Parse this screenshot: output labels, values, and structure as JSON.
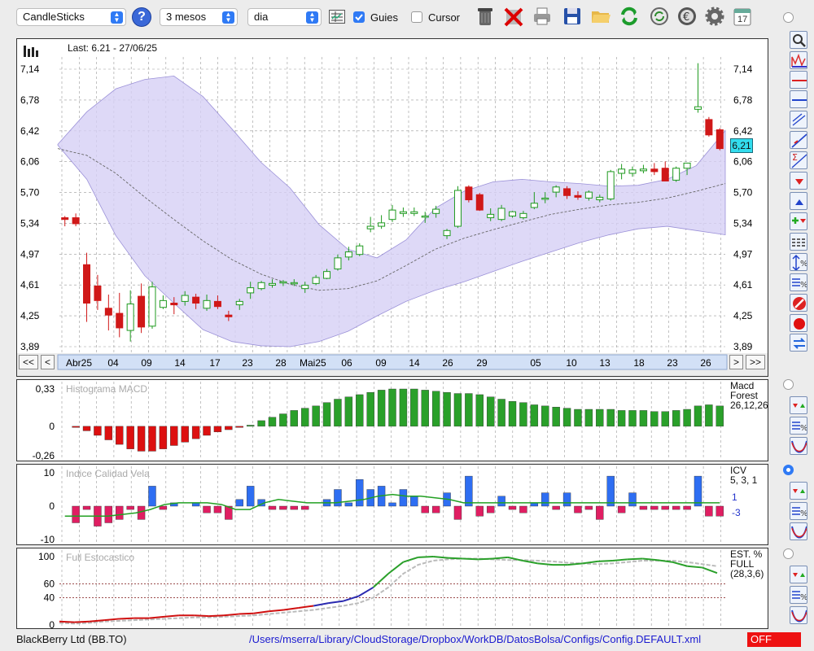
{
  "toolbar": {
    "chart_type": "CandleSticks",
    "period": "3 mesos",
    "interval": "dia",
    "guides_label": "Guies",
    "guides_checked": true,
    "cursor_label": "Cursor",
    "cursor_checked": false,
    "icons": [
      "help-icon",
      "table-icon",
      "trash-icon",
      "delete-icon",
      "printer-icon",
      "save-icon",
      "open-folder-icon",
      "refresh-icon",
      "sync-icon",
      "euro-icon",
      "gear-icon",
      "calendar-icon"
    ],
    "calendar_day": "17"
  },
  "main_chart": {
    "last_label": "Last: 6.21 - 27/06/25",
    "price_tag": "6,21",
    "y_ticks": [
      "7,14",
      "6,78",
      "6,42",
      "6,06",
      "5,70",
      "5,34",
      "4,97",
      "4,61",
      "4,25",
      "3,89"
    ],
    "x_labels": [
      "Abr25",
      "04",
      "09",
      "14",
      "17",
      "23",
      "28",
      "Mai25",
      "06",
      "09",
      "14",
      "26",
      "29",
      "05",
      "10",
      "13",
      "18",
      "23",
      "26"
    ],
    "nav_left": [
      "<<",
      "<"
    ],
    "nav_right": [
      ">",
      ">>"
    ],
    "ylim": [
      3.89,
      7.14
    ]
  },
  "chart_data": [
    {
      "type": "candlestick",
      "title": "",
      "y_ticks": [
        "7,14",
        "6,78",
        "6,42",
        "6,06",
        "5,70",
        "5,34",
        "4,97",
        "4,61",
        "4,25",
        "3,89"
      ],
      "x_labels": [
        "Abr25",
        "04",
        "09",
        "14",
        "17",
        "23",
        "28",
        "Mai25",
        "06",
        "09",
        "14",
        "26",
        "29",
        "05",
        "10",
        "13",
        "18",
        "23",
        "26"
      ],
      "ylim": [
        3.89,
        7.14
      ],
      "last": 6.21,
      "candles": [
        [
          5.4,
          5.42,
          5.3,
          5.38
        ],
        [
          5.4,
          5.45,
          5.3,
          5.33
        ],
        [
          4.85,
          4.99,
          4.18,
          4.4
        ],
        [
          4.6,
          4.73,
          4.32,
          4.43
        ],
        [
          4.34,
          4.5,
          4.08,
          4.26
        ],
        [
          4.28,
          4.52,
          4.0,
          4.11
        ],
        [
          4.08,
          4.55,
          3.95,
          4.39
        ],
        [
          4.48,
          4.63,
          4.05,
          4.12
        ],
        [
          4.13,
          4.65,
          4.1,
          4.59
        ],
        [
          4.35,
          4.49,
          4.33,
          4.43
        ],
        [
          4.4,
          4.47,
          4.27,
          4.38
        ],
        [
          4.42,
          4.54,
          4.37,
          4.49
        ],
        [
          4.47,
          4.51,
          4.33,
          4.4
        ],
        [
          4.34,
          4.5,
          4.31,
          4.43
        ],
        [
          4.42,
          4.49,
          4.33,
          4.36
        ],
        [
          4.26,
          4.31,
          4.19,
          4.24
        ],
        [
          4.38,
          4.45,
          4.32,
          4.42
        ],
        [
          4.52,
          4.65,
          4.45,
          4.58
        ],
        [
          4.57,
          4.66,
          4.55,
          4.64
        ],
        [
          4.61,
          4.68,
          4.58,
          4.63
        ],
        [
          4.64,
          4.67,
          4.6,
          4.65
        ],
        [
          4.63,
          4.68,
          4.6,
          4.64
        ],
        [
          4.57,
          4.65,
          4.52,
          4.61
        ],
        [
          4.63,
          4.73,
          4.61,
          4.7
        ],
        [
          4.69,
          4.8,
          4.68,
          4.77
        ],
        [
          4.8,
          4.97,
          4.78,
          4.93
        ],
        [
          4.94,
          5.06,
          4.9,
          5.0
        ],
        [
          4.97,
          5.1,
          4.95,
          5.07
        ],
        [
          5.27,
          5.41,
          5.23,
          5.3
        ],
        [
          5.3,
          5.43,
          5.27,
          5.34
        ],
        [
          5.38,
          5.55,
          5.35,
          5.49
        ],
        [
          5.45,
          5.52,
          5.41,
          5.47
        ],
        [
          5.45,
          5.52,
          5.42,
          5.47
        ],
        [
          5.42,
          5.47,
          5.34,
          5.42
        ],
        [
          5.45,
          5.54,
          5.4,
          5.5
        ],
        [
          5.19,
          5.27,
          5.15,
          5.25
        ],
        [
          5.3,
          5.77,
          5.28,
          5.72
        ],
        [
          5.76,
          5.78,
          5.58,
          5.61
        ],
        [
          5.67,
          5.69,
          5.48,
          5.49
        ],
        [
          5.4,
          5.51,
          5.36,
          5.44
        ],
        [
          5.38,
          5.55,
          5.36,
          5.51
        ],
        [
          5.42,
          5.48,
          5.4,
          5.47
        ],
        [
          5.4,
          5.48,
          5.38,
          5.45
        ],
        [
          5.52,
          5.7,
          5.5,
          5.57
        ],
        [
          5.63,
          5.7,
          5.57,
          5.63
        ],
        [
          5.7,
          5.78,
          5.64,
          5.76
        ],
        [
          5.74,
          5.77,
          5.62,
          5.66
        ],
        [
          5.66,
          5.71,
          5.61,
          5.64
        ],
        [
          5.63,
          5.72,
          5.6,
          5.7
        ],
        [
          5.61,
          5.67,
          5.58,
          5.64
        ],
        [
          5.62,
          5.96,
          5.6,
          5.94
        ],
        [
          5.92,
          6.03,
          5.85,
          5.97
        ],
        [
          5.92,
          6.0,
          5.88,
          5.96
        ],
        [
          5.95,
          6.02,
          5.92,
          5.97
        ],
        [
          5.97,
          6.04,
          5.9,
          5.94
        ],
        [
          5.98,
          6.06,
          5.83,
          5.83
        ],
        [
          5.84,
          6.0,
          5.82,
          5.98
        ],
        [
          5.98,
          6.04,
          5.9,
          6.04
        ],
        [
          6.67,
          7.21,
          6.63,
          6.7
        ],
        [
          6.55,
          6.58,
          6.35,
          6.37
        ],
        [
          6.43,
          6.45,
          6.19,
          6.21
        ]
      ],
      "bands": {
        "upper": [
          6.26,
          6.64,
          6.91,
          7.02,
          7.06,
          6.82,
          6.44,
          6.05,
          5.75,
          5.32,
          5.03,
          4.93,
          5.14,
          5.51,
          5.71,
          5.82,
          5.85,
          5.82,
          5.8,
          5.77,
          5.78,
          5.85,
          6.01,
          6.42
        ],
        "lower": [
          6.25,
          5.85,
          5.19,
          4.72,
          4.4,
          4.09,
          3.95,
          3.9,
          3.89,
          3.95,
          4.07,
          4.25,
          4.42,
          4.55,
          4.65,
          4.77,
          4.89,
          5.0,
          5.11,
          5.2,
          5.27,
          5.3,
          5.25,
          5.2
        ],
        "mid": [
          6.21,
          6.13,
          5.92,
          5.64,
          5.38,
          5.13,
          4.91,
          4.74,
          4.62,
          4.55,
          4.57,
          4.66,
          4.84,
          5.03,
          5.16,
          5.26,
          5.35,
          5.44,
          5.5,
          5.55,
          5.58,
          5.63,
          5.71,
          5.8
        ]
      }
    },
    {
      "type": "bar",
      "title": "Histograma MACD",
      "legend": [
        "Macd",
        "Forest",
        "26,12,26"
      ],
      "y_ticks": [
        "0,33",
        "0",
        "-0,26"
      ],
      "ylim": [
        -0.26,
        0.33
      ],
      "values": [
        0,
        -0.01,
        -0.04,
        -0.08,
        -0.12,
        -0.16,
        -0.2,
        -0.22,
        -0.22,
        -0.2,
        -0.17,
        -0.14,
        -0.11,
        -0.08,
        -0.05,
        -0.03,
        -0.01,
        0.01,
        0.05,
        0.08,
        0.11,
        0.14,
        0.16,
        0.18,
        0.21,
        0.24,
        0.26,
        0.28,
        0.3,
        0.32,
        0.33,
        0.33,
        0.33,
        0.32,
        0.31,
        0.3,
        0.29,
        0.29,
        0.28,
        0.26,
        0.24,
        0.22,
        0.21,
        0.19,
        0.18,
        0.17,
        0.16,
        0.15,
        0.15,
        0.15,
        0.15,
        0.14,
        0.14,
        0.14,
        0.13,
        0.13,
        0.14,
        0.15,
        0.18,
        0.19,
        0.18
      ]
    },
    {
      "type": "bar",
      "title": "Indice Calidad Vela",
      "legend": [
        "ICV",
        "5, 3, 1",
        "1",
        "-3"
      ],
      "y_ticks": [
        "10",
        "0",
        "-10"
      ],
      "ylim": [
        -10,
        10
      ],
      "values": [
        0,
        -5,
        -1,
        -6,
        -5,
        -4,
        -1,
        -4,
        6,
        -1,
        1,
        0,
        1,
        -2,
        -2,
        -4,
        2,
        6,
        2,
        -1,
        -1,
        -1,
        -1,
        0,
        2,
        5,
        1,
        8,
        5,
        6,
        1,
        5,
        3,
        -2,
        -2,
        4,
        -4,
        9,
        -3,
        -2,
        3,
        -1,
        -2,
        1,
        4,
        -1,
        4,
        -2,
        -1,
        -4,
        9,
        -2,
        4,
        -1,
        -1,
        -1,
        -1,
        -1,
        9,
        -3,
        -3
      ],
      "signal": [
        -3,
        -3,
        -3,
        -3,
        -2.5,
        -2,
        -1,
        0.5,
        1,
        1,
        1,
        0.5,
        -1,
        -1,
        1,
        2,
        1.5,
        1,
        1,
        1,
        1.5,
        2,
        3,
        3.5,
        3,
        3,
        2.5,
        2,
        1,
        1,
        1,
        1,
        1,
        1,
        1,
        1,
        1,
        1,
        1,
        1,
        1,
        1,
        1,
        1,
        1,
        1,
        1
      ]
    },
    {
      "type": "line",
      "title": "Full Estocastico",
      "legend": [
        "EST. %",
        "FULL",
        "(28,3,6)"
      ],
      "y_ticks": [
        "100",
        "60",
        "40",
        "0"
      ],
      "ylim": [
        0,
        100
      ],
      "k": [
        5,
        4,
        5,
        7,
        9,
        10,
        10,
        12,
        14,
        14,
        13,
        14,
        16,
        17,
        20,
        22,
        25,
        28,
        32,
        35,
        42,
        55,
        75,
        92,
        99,
        100,
        98,
        97,
        96,
        97,
        99,
        94,
        90,
        88,
        88,
        90,
        93,
        94,
        96,
        97,
        95,
        92,
        86,
        84,
        76
      ],
      "d": [
        3,
        2,
        3,
        5,
        6,
        7,
        8,
        9,
        10,
        11,
        11,
        12,
        13,
        14,
        16,
        18,
        20,
        22,
        25,
        28,
        32,
        40,
        55,
        75,
        88,
        94,
        96,
        97,
        97,
        96,
        95,
        95,
        94,
        93,
        91,
        90,
        89,
        90,
        92,
        94,
        94,
        94,
        92,
        89,
        86
      ]
    }
  ],
  "panels": {
    "macd": {
      "title": "Histograma MACD",
      "legend": [
        "Macd",
        "Forest",
        "26,12,26"
      ]
    },
    "icv": {
      "title": "Indice Calidad Vela",
      "legend": [
        "ICV",
        "5, 3, 1",
        "1",
        "-3"
      ]
    },
    "stoch": {
      "title": "Full Estocastico",
      "legend": [
        "EST. %",
        "FULL",
        "(28,3,6)"
      ]
    }
  },
  "right_toolbar": [
    "zoom-icon",
    "pattern-icon",
    "horizontal-line-red-icon",
    "horizontal-line-blue-icon",
    "channel-icon",
    "trendline-icon",
    "fibonacci-icon",
    "arrow-down-red-icon",
    "arrow-up-blue-icon",
    "add-remove-icon",
    "lines-icon",
    "percent-range-icon",
    "percent-icon",
    "stop-icon",
    "record-icon",
    "swap-icon"
  ],
  "status": {
    "instrument": "BlackBerry Ltd (BB.TO)",
    "path": "/Users/mserra/Library/CloudStorage/Dropbox/WorkDB/DatosBolsa/Configs/Config.DEFAULT.xml",
    "mode": "OFF"
  },
  "colors": {
    "up": "#1f9a1f",
    "down": "#d01818",
    "band_fill": "#d6d0f5",
    "band_stroke": "#9b91d8",
    "macd_up": "#2aa02a",
    "macd_down": "#dd1010",
    "icv_pos": "#2e6ef2",
    "icv_neg": "#e01e62",
    "stoch_k": "#2aa02a",
    "stoch_d": "#bbbbbb"
  }
}
